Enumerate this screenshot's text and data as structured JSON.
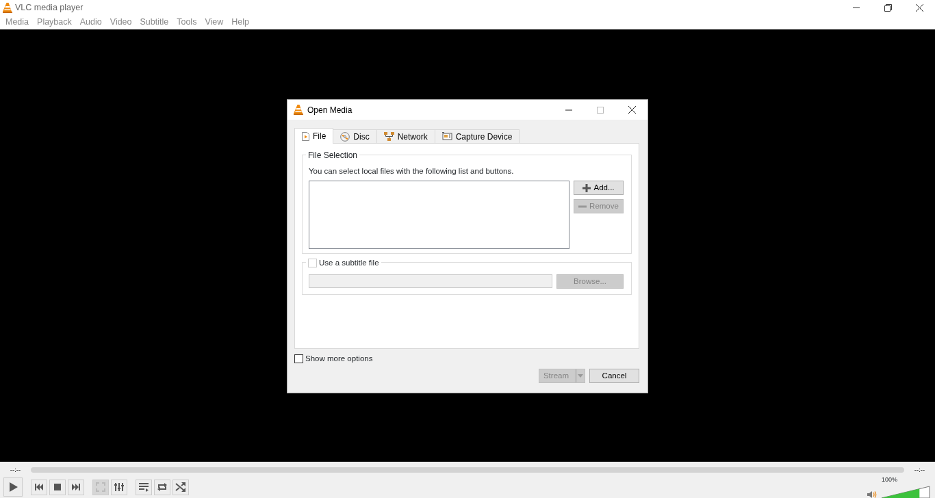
{
  "window": {
    "title": "VLC media player"
  },
  "menu": [
    "Media",
    "Playback",
    "Audio",
    "Video",
    "Subtitle",
    "Tools",
    "View",
    "Help"
  ],
  "dialog": {
    "title": "Open Media",
    "tabs": [
      {
        "label": "File",
        "kind": "file",
        "selected": true
      },
      {
        "label": "Disc",
        "kind": "disc",
        "selected": false
      },
      {
        "label": "Network",
        "kind": "network",
        "selected": false
      },
      {
        "label": "Capture Device",
        "kind": "capture",
        "selected": false
      }
    ],
    "file_selection": {
      "legend": "File Selection",
      "hint": "You can select local files with the following list and buttons.",
      "buttons": [
        {
          "label": "Add...",
          "kind": "add",
          "disabled": false
        },
        {
          "label": "Remove",
          "kind": "remove",
          "disabled": true
        }
      ]
    },
    "subtitle": {
      "label": "Use a subtitle file",
      "checked": false,
      "browse": {
        "label": "Browse...",
        "disabled": true
      }
    },
    "show_more": {
      "label": "Show more options",
      "checked": false
    },
    "buttons": [
      {
        "label": "Stream",
        "kind": "split",
        "disabled": true
      },
      {
        "label": "Cancel",
        "kind": "plain",
        "disabled": false
      }
    ]
  },
  "controls": {
    "elapsed": "--:--",
    "remaining": "--:--",
    "button_groups": [
      [
        {
          "kind": "play",
          "disabled": false
        }
      ],
      [
        {
          "kind": "previous",
          "disabled": false
        },
        {
          "kind": "stop",
          "disabled": false
        },
        {
          "kind": "next",
          "disabled": false
        }
      ],
      [
        {
          "kind": "fullscreen",
          "disabled": true
        },
        {
          "kind": "equalizer",
          "disabled": false
        }
      ],
      [
        {
          "kind": "playlist",
          "disabled": false
        },
        {
          "kind": "loop",
          "disabled": false
        },
        {
          "kind": "shuffle",
          "disabled": false
        }
      ]
    ],
    "volume": {
      "reading": "100%",
      "level": 0.79
    }
  }
}
